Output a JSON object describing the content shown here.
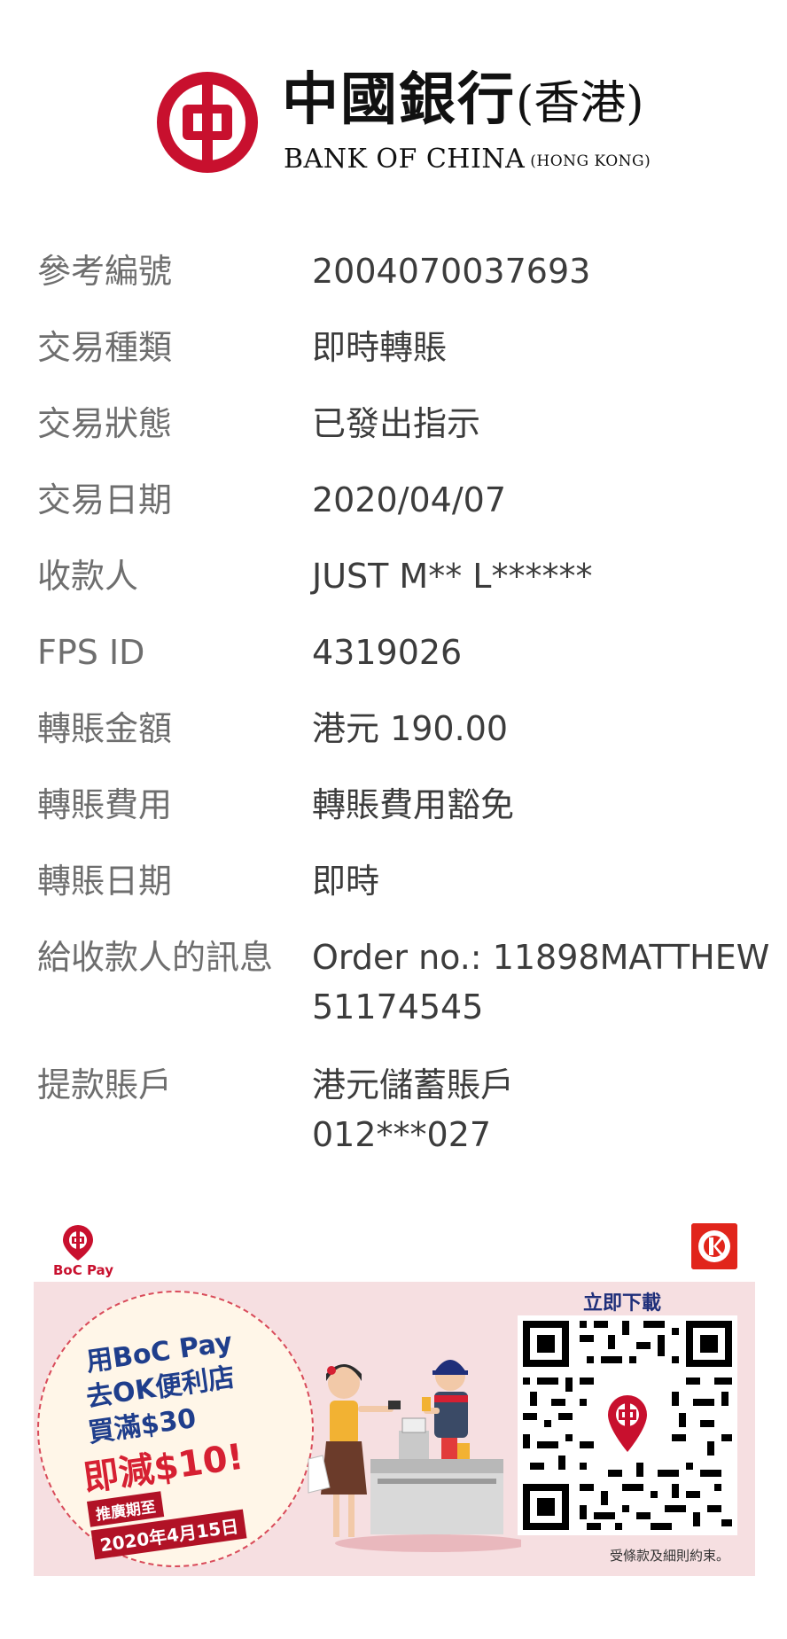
{
  "header": {
    "chinese_name": "中國銀行",
    "chinese_region": "(香港)",
    "english_name": "BANK OF CHINA",
    "english_region": "(HONG KONG)",
    "brand_color": "#c8102e"
  },
  "details": [
    {
      "label": "參考編號",
      "value": "2004070037693"
    },
    {
      "label": "交易種類",
      "value": "即時轉賬"
    },
    {
      "label": "交易狀態",
      "value": "已發出指示"
    },
    {
      "label": "交易日期",
      "value": "2020/04/07"
    },
    {
      "label": "收款人",
      "value": "JUST M** L******"
    },
    {
      "label": "FPS ID",
      "value": "4319026"
    },
    {
      "label": "轉賬金額",
      "value": "港元 190.00"
    },
    {
      "label": "轉賬費用",
      "value": "轉賬費用豁免"
    },
    {
      "label": "轉賬日期",
      "value": "即時"
    },
    {
      "label": "給收款人的訊息",
      "value": "Order no.: 11898MATTHEW",
      "value2": "51174545"
    },
    {
      "label": "提款賬戶",
      "value": "港元儲蓄賬戶",
      "value2": "012***027"
    }
  ],
  "promo": {
    "bocpay_label": "BoC Pay",
    "line1": "用BoC Pay",
    "line2": "去OK便利店",
    "line3": "買滿$30",
    "line4": "即減$10!",
    "period_label": "推廣期至",
    "period_date": "2020年4月15日",
    "download_label": "立即下載",
    "terms": "受條款及細則約束。",
    "banner_color": "#f6dfe1"
  }
}
